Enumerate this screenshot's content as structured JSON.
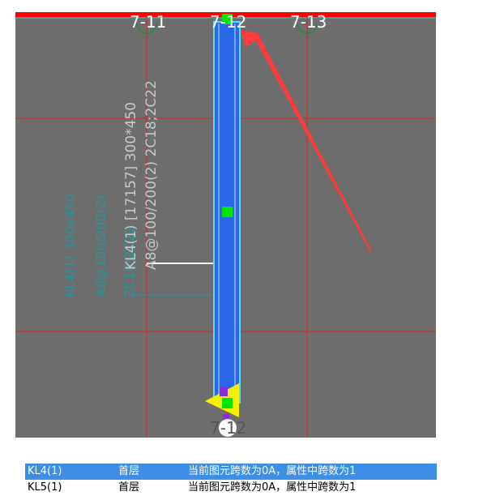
{
  "canvas": {
    "background": "#6e6e6e",
    "grid_color": "#e0221d",
    "axes_top": [
      "7-11",
      "7-12",
      "7-13"
    ],
    "axis_bottom": "7-12"
  },
  "beam": {
    "label_original": "KL4(1) [17157] 300*450",
    "label_rebar": "A8@100/200(2) 2C18;2C22",
    "teal_labels": [
      "KL4(1) 300x450",
      "A8@100/200(2)",
      "2C18;2C22"
    ],
    "fill_color": "#2a67e8",
    "outline_color": "#62d6ff",
    "grip_color": "#00e600"
  },
  "error_list": {
    "rows": [
      {
        "member": "KL4(1)",
        "floor": "首层",
        "message": "当前图元跨数为0A，属性中跨数为1",
        "selected": true
      },
      {
        "member": "KL5(1)",
        "floor": "首层",
        "message": "当前图元跨数为0A，属性中跨数为1",
        "selected": false
      }
    ]
  }
}
